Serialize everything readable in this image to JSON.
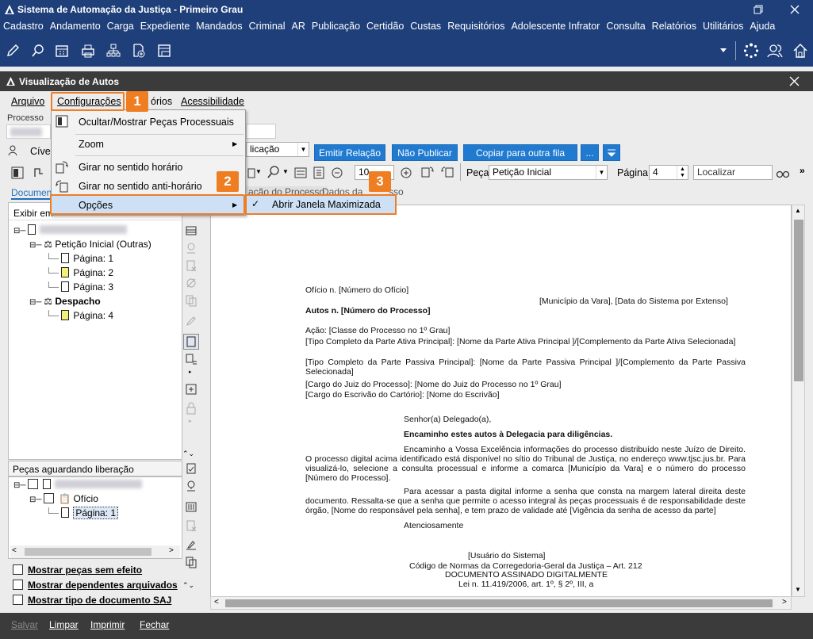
{
  "app": {
    "title": "Sistema de Automação da Justiça - Primeiro Grau"
  },
  "main_menu": [
    "Cadastro",
    "Andamento",
    "Carga",
    "Expediente",
    "Mandados",
    "Criminal",
    "AR",
    "Publicação",
    "Certidão",
    "Custas",
    "Requisitórios",
    "Adolescente Infrator",
    "Consulta",
    "Relatórios",
    "Utilitários",
    "Ajuda"
  ],
  "inner": {
    "title": "Visualização de Autos"
  },
  "inner_menu": {
    "arquivo": "Arquivo",
    "configuracoes": "Configurações",
    "relatorios": "órios",
    "acessibilidade": "Acessibilidade"
  },
  "processo_label": "Processo",
  "civel_label": "Cível",
  "publicacao_combo": "licação",
  "buttons": {
    "emitir": "Emitir Relação",
    "nao_publicar": "Não Publicar",
    "copiar": "Copiar para outra fila",
    "more": "..."
  },
  "toolbar": {
    "zoom_value": "10",
    "peca_label": "Peça",
    "peca_value": "Petição Inicial",
    "pagina_label": "Página",
    "pagina_value": "4",
    "localizar": "Localizar"
  },
  "tabs": {
    "documentos": "Documen",
    "dados_processo": "ação do Processo",
    "dados_da": "Dados da",
    "dados_tail": "sso"
  },
  "exibir_label": "Exibir em",
  "tree": {
    "peticao": "Petição Inicial (Outras)",
    "p1": "Página: 1",
    "p2": "Página: 2",
    "p3": "Página: 3",
    "despacho": "Despacho",
    "p4": "Página: 4"
  },
  "pecas_aguardando": "Peças aguardando liberação",
  "tree2": {
    "oficio": "Ofício",
    "p1": "Página: 1"
  },
  "checkboxes": {
    "sem_efeito": "Mostrar peças sem efeito",
    "dependentes": "Mostrar dependentes arquivados",
    "tipo": "Mostrar tipo de documento SAJ"
  },
  "menu": {
    "ocultar": "Ocultar/Mostrar Peças Processuais",
    "zoom": "Zoom",
    "horario": "Girar no sentido horário",
    "anti_horario": "Girar no sentido anti-horário",
    "opcoes": "Opções"
  },
  "submenu": {
    "maximizada": "Abrir Janela Maximizada"
  },
  "badges": {
    "b1": "1",
    "b2": "2",
    "b3": "3"
  },
  "document": {
    "l1": "Ofício n. [Número do Ofício]",
    "l2": "[Município da Vara], [Data do Sistema por Extenso]",
    "l3": "Autos n. [Número do Processo]",
    "l4": "Ação: [Classe do Processo no 1º Grau]",
    "l5": "[Tipo Completo da Parte Ativa Principal]: [Nome da Parte Ativa Principal ]/[Complemento da Parte Ativa Selecionada]",
    "l6": "[Tipo Completo da Parte Passiva Principal]: [Nome da Parte Passiva Principal ]/[Complemento da Parte Passiva Selecionada]",
    "l7": "[Cargo do Juiz do Processo]: [Nome do Juiz do Processo no 1º Grau]",
    "l8": "[Cargo do Escrivão do Cartório]: [Nome do Escrivão]",
    "l9": "Senhor(a) Delegado(a),",
    "l10": "Encaminho estes autos à Delegacia para diligências.",
    "l11": "Encaminho a Vossa Excelência informações do processo distribuído neste Juízo de Direito. O processo digital acima identificado está disponível no sítio do Tribunal de Justiça, no endereço www.tjsc.jus.br. Para visualizá-lo, selecione a consulta processual e informe a comarca [Município da Vara] e o número do processo [Número do Processo].",
    "l12": "Para acessar a pasta digital informe a senha que consta na margem lateral direita deste documento. Ressalta-se que a senha que permite o acesso integral às peças processuais é de responsabilidade deste órgão, [Nome do responsável pela senha], e tem prazo de validade até [Vigência da senha de acesso da parte]",
    "l13": "Atenciosamente",
    "l14": "[Usuário do Sistema]",
    "l15": "Código de Normas da Corregedoria-Geral da Justiça – Art. 212",
    "l16": "DOCUMENTO ASSINADO DIGITALMENTE",
    "l17": "Lei n. 11.419/2006, art. 1º, § 2º, III, a"
  },
  "bottom": {
    "salvar": "Salvar",
    "limpar": "Limpar",
    "imprimir": "Imprimir",
    "fechar": "Fechar"
  },
  "colors": {
    "title_bg": "#1e3f7a",
    "accent": "#ef7d22",
    "button_blue": "#1f7ad0"
  }
}
